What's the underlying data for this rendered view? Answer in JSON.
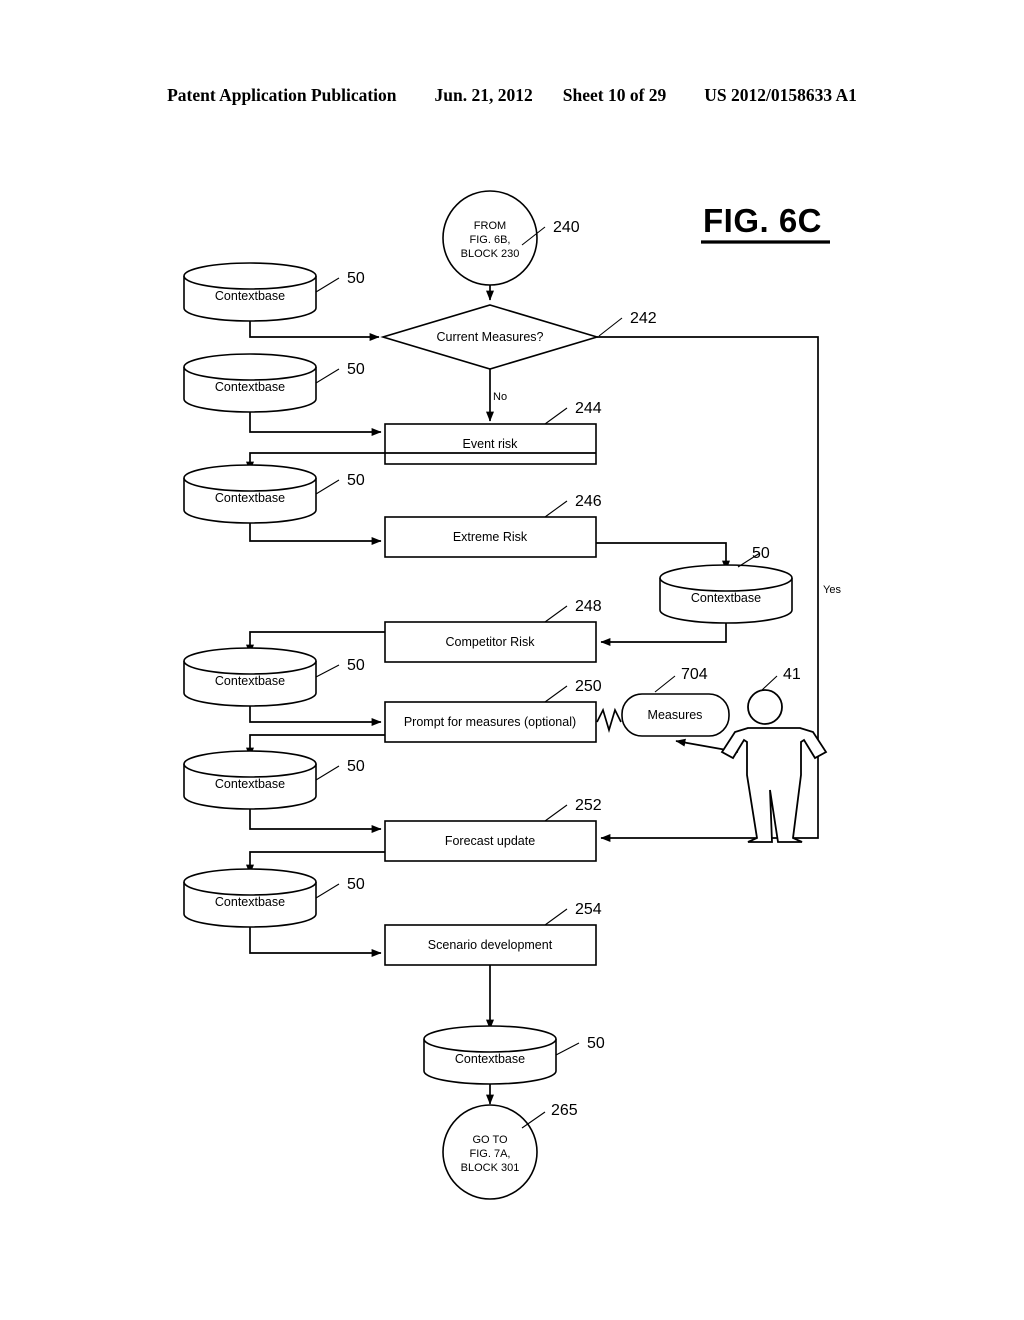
{
  "header": {
    "publication": "Patent Application Publication",
    "date": "Jun. 21, 2012",
    "sheet": "Sheet 10 of 29",
    "patent_number": "US 2012/0158633 A1"
  },
  "figure": {
    "title": "FIG. 6C"
  },
  "nodes": {
    "entry_terminal": {
      "line1": "FROM",
      "line2": "FIG. 6B,",
      "line3": "BLOCK 230",
      "ref": "240"
    },
    "decision": {
      "label": "Current Measures?",
      "ref": "242",
      "yes_label": "Yes",
      "no_label": "No"
    },
    "event_risk": {
      "label": "Event risk",
      "ref": "244"
    },
    "extreme_risk": {
      "label": "Extreme Risk",
      "ref": "246"
    },
    "competitor_risk": {
      "label": "Competitor Risk",
      "ref": "248"
    },
    "prompt_measures": {
      "label": "Prompt for measures (optional)",
      "ref": "250"
    },
    "forecast_update": {
      "label": "Forecast update",
      "ref": "252"
    },
    "scenario_development": {
      "label": "Scenario development",
      "ref": "254"
    },
    "measures_bubble": {
      "label": "Measures",
      "ref": "704"
    },
    "user_actor": {
      "ref": "41"
    },
    "exit_terminal": {
      "line1": "GO TO",
      "line2": "FIG. 7A,",
      "line3": "BLOCK 301",
      "ref": "265"
    }
  },
  "datastores": {
    "label": "Contextbase",
    "ref": "50",
    "instances": [
      {
        "id": "contextbase-1",
        "ref": "50",
        "label": "Contextbase"
      },
      {
        "id": "contextbase-2",
        "ref": "50",
        "label": "Contextbase"
      },
      {
        "id": "contextbase-3",
        "ref": "50",
        "label": "Contextbase"
      },
      {
        "id": "contextbase-4",
        "ref": "50",
        "label": "Contextbase"
      },
      {
        "id": "contextbase-5",
        "ref": "50",
        "label": "Contextbase"
      },
      {
        "id": "contextbase-6",
        "ref": "50",
        "label": "Contextbase"
      },
      {
        "id": "contextbase-right",
        "ref": "50",
        "label": "Contextbase"
      },
      {
        "id": "contextbase-bottom",
        "ref": "50",
        "label": "Contextbase"
      }
    ]
  },
  "colors": {
    "ink": "#000000",
    "paper": "#ffffff"
  }
}
